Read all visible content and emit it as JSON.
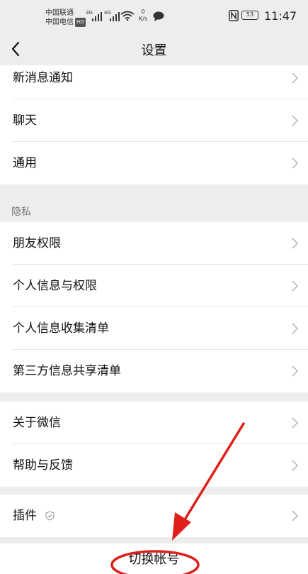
{
  "status_bar": {
    "carrier_1": "中国联通",
    "carrier_2": "中国电信",
    "carrier_2_badge": "HD",
    "network_1": "3G",
    "network_2": "4G",
    "speed_value": "0",
    "speed_unit": "K/s",
    "battery": "53",
    "time": "11:47"
  },
  "nav": {
    "title": "设置"
  },
  "groups": [
    {
      "items": [
        {
          "label": "新消息通知"
        },
        {
          "label": "聊天"
        },
        {
          "label": "通用"
        }
      ]
    },
    {
      "header": "隐私",
      "items": [
        {
          "label": "朋友权限"
        },
        {
          "label": "个人信息与权限"
        },
        {
          "label": "个人信息收集清单"
        },
        {
          "label": "第三方信息共享清单"
        }
      ]
    },
    {
      "items": [
        {
          "label": "关于微信"
        },
        {
          "label": "帮助与反馈"
        }
      ]
    },
    {
      "items": [
        {
          "label": "插件"
        }
      ]
    }
  ],
  "switch_account": {
    "label": "切换帐号"
  },
  "colors": {
    "background": "#ededed",
    "annotation": "#e0201a"
  }
}
